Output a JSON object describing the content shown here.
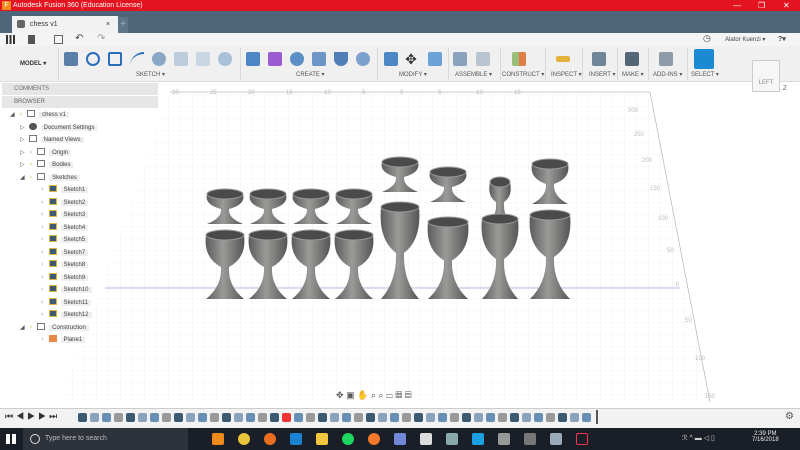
{
  "window": {
    "title": "Autodesk Fusion 360 (Education License)",
    "logo": "F",
    "minimize": "—",
    "maximize": "❐",
    "close": "✕"
  },
  "tab": {
    "name": "chess v1",
    "close": "×",
    "new": "+"
  },
  "quickbar": {
    "user": "Alator Kuenzi ▾",
    "help": "?▾"
  },
  "ribbon": {
    "workspace": "MODEL ▾",
    "groups": [
      "SKETCH ▾",
      "CREATE ▾",
      "MODIFY ▾",
      "ASSEMBLE ▾",
      "CONSTRUCT ▾",
      "INSPECT ▾",
      "INSERT ▾",
      "MAKE ▾",
      "ADD-INS ▾",
      "SELECT ▾"
    ]
  },
  "panels": {
    "comments": "COMMENTS",
    "browser": "BROWSER"
  },
  "browser": {
    "root": "chess v1",
    "items": [
      "Document Settings",
      "Named Views",
      "Origin",
      "Bodies",
      "Sketches"
    ],
    "sketches": [
      "Sketch1",
      "Sketch2",
      "Sketch3",
      "Sketch4",
      "Sketch5",
      "Sketch7",
      "Sketch8",
      "Sketch9",
      "Sketch10",
      "Sketch11",
      "Sketch12"
    ],
    "construction": "Construction",
    "plane": "Plane1"
  },
  "viewcube": {
    "face": "LEFT",
    "axis": "Z"
  },
  "rulers": {
    "top": [
      "30",
      "25",
      "20",
      "15",
      "10",
      "5",
      "0",
      "5",
      "10",
      "15"
    ],
    "right": [
      "300",
      "250",
      "200",
      "150",
      "100",
      "50",
      "0",
      "50",
      "100",
      "150"
    ]
  },
  "taskbar": {
    "search_placeholder": "Type here to search",
    "time": "2:39 PM",
    "date": "7/16/2018"
  },
  "colors": {
    "titlebar": "#e3141f",
    "tabbar": "#4f6579",
    "select": "#1b8ad3"
  }
}
